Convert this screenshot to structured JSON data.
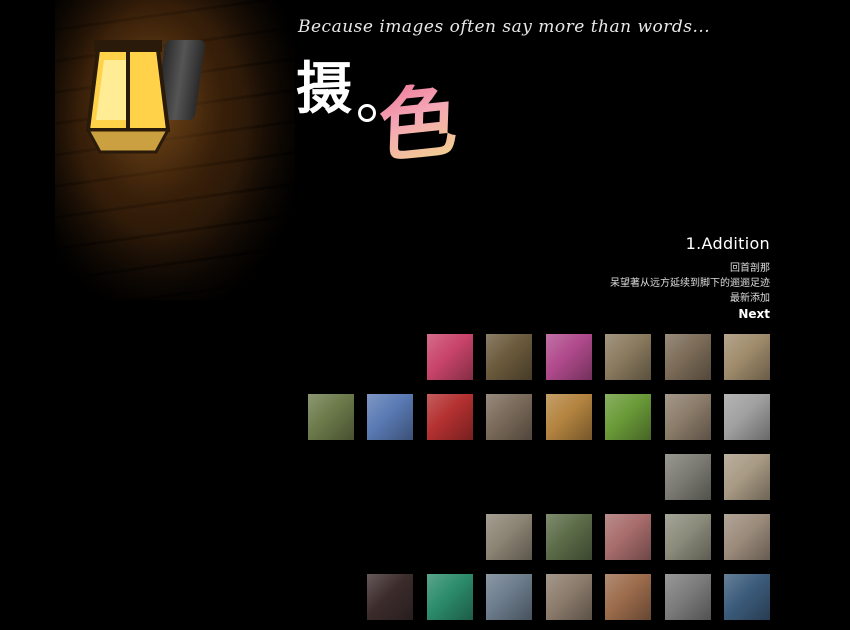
{
  "header": {
    "tagline": "Because images often say more than words...",
    "logo_main": "摄",
    "logo_accent": "色"
  },
  "nav": {
    "title": "1.Addition",
    "links": [
      "回首剖那",
      "呆望著从远方延续到脚下的逦逦足迹",
      "最新添加"
    ],
    "next_label": "Next"
  },
  "colors": {
    "background": "#000000",
    "logo_gradient": [
      "#f07a9a",
      "#f4a6b6",
      "#f2d38a"
    ]
  },
  "gallery": {
    "rows": [
      [
        "#c9446a",
        "#6b5a3c",
        "#b04a8c",
        "#8a7a5e",
        "#7c6c58",
        "#a08c6c"
      ],
      [
        "#6c7a4a",
        "#5a7ab4",
        "#b43030",
        "#7a6a5a",
        "#b48440",
        "#6a9a38",
        "#8c7c6a",
        "#a0a0a0"
      ],
      [
        "#7c7c74",
        "#a89a84"
      ],
      [
        "#8c8474",
        "#5c6c48",
        "#a86c6c",
        "#8c8c7c",
        "#9c8c7c"
      ],
      [
        "#3c2c2c",
        "#2c8c6c",
        "#6c7c8c",
        "#8c7c6c",
        "#9c6c4c",
        "#7c7c7c",
        "#3c5c7c"
      ]
    ]
  }
}
